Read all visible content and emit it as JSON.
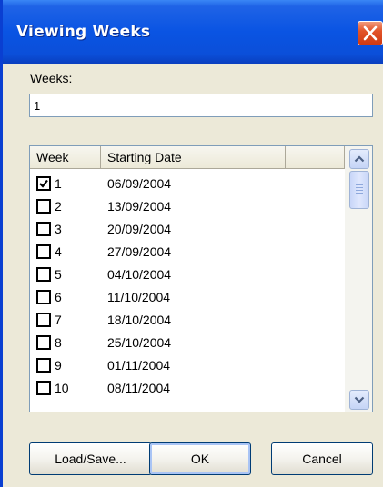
{
  "window": {
    "title": "Viewing Weeks",
    "close_icon": "close-icon",
    "accent_color": "#0a54e3"
  },
  "weeks_field": {
    "label": "Weeks:",
    "value": "1"
  },
  "list": {
    "columns": [
      "Week",
      "Starting Date",
      ""
    ],
    "rows": [
      {
        "week": "1",
        "date": "06/09/2004",
        "checked": true
      },
      {
        "week": "2",
        "date": "13/09/2004",
        "checked": false
      },
      {
        "week": "3",
        "date": "20/09/2004",
        "checked": false
      },
      {
        "week": "4",
        "date": "27/09/2004",
        "checked": false
      },
      {
        "week": "5",
        "date": "04/10/2004",
        "checked": false
      },
      {
        "week": "6",
        "date": "11/10/2004",
        "checked": false
      },
      {
        "week": "7",
        "date": "18/10/2004",
        "checked": false
      },
      {
        "week": "8",
        "date": "25/10/2004",
        "checked": false
      },
      {
        "week": "9",
        "date": "01/11/2004",
        "checked": false
      },
      {
        "week": "10",
        "date": "08/11/2004",
        "checked": false
      }
    ]
  },
  "buttons": {
    "load_save": "Load/Save...",
    "ok": "OK",
    "cancel": "Cancel"
  }
}
